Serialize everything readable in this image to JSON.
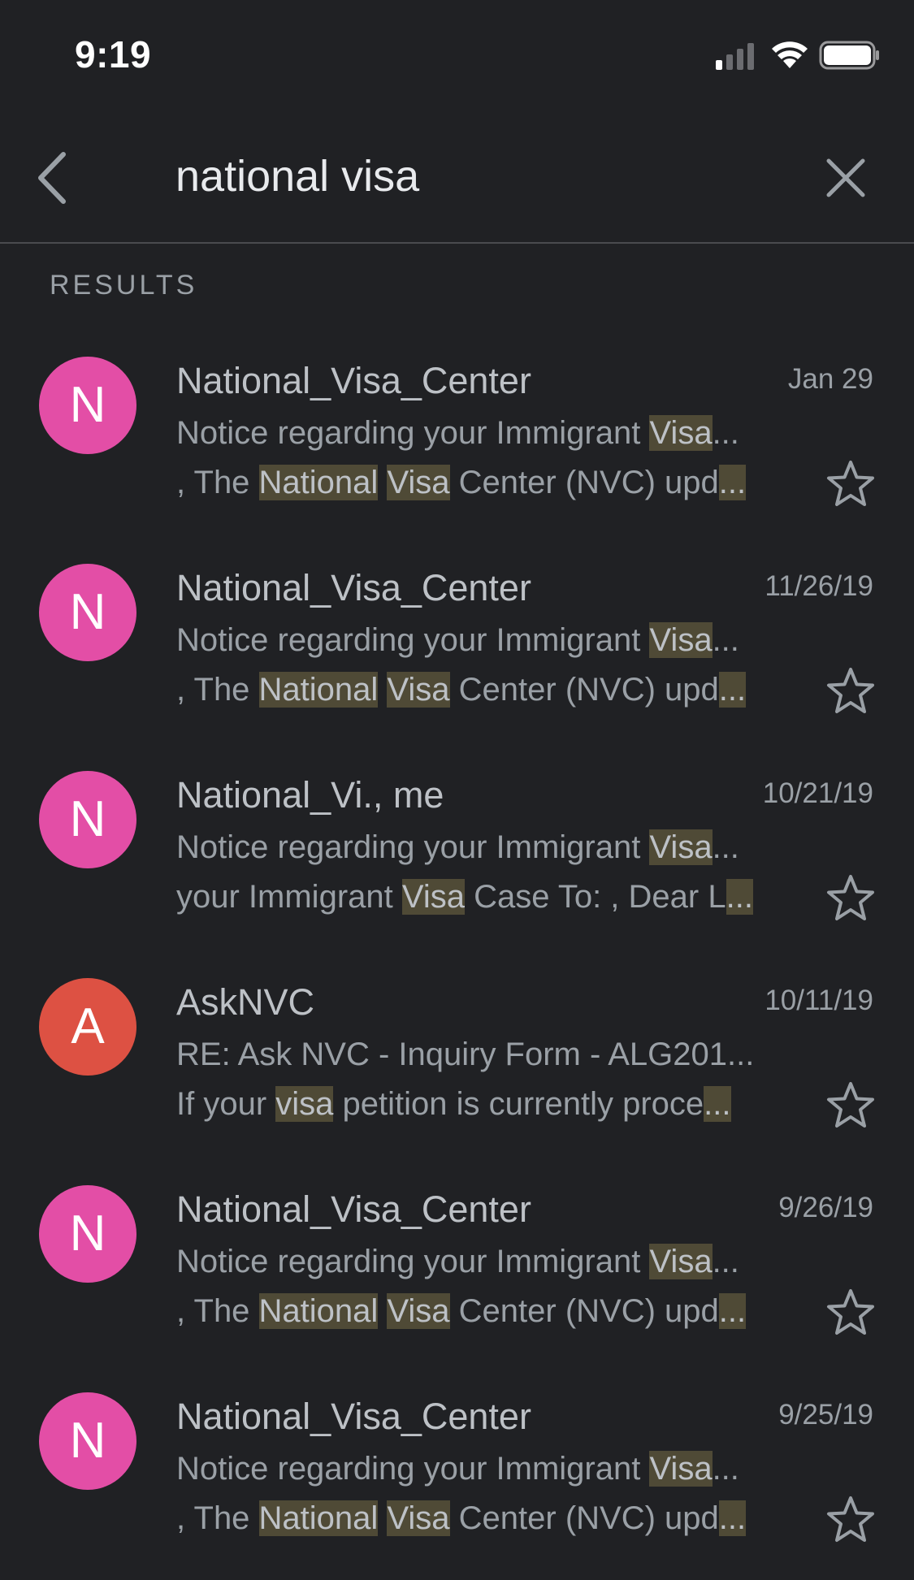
{
  "status_bar": {
    "time": "9:19"
  },
  "search": {
    "query": "national visa"
  },
  "results_label": "RESULTS",
  "colors": {
    "avatar_pink": "#e34ea6",
    "avatar_orange": "#dd5143",
    "highlight": "#4f4a36",
    "background": "#202124"
  },
  "emails": [
    {
      "avatar_letter": "N",
      "avatar_color": "#e34ea6",
      "sender": "National_Visa_Center",
      "date": "Jan 29",
      "subject": [
        {
          "t": "Notice regarding your Immigrant ",
          "h": false
        },
        {
          "t": "Visa",
          "h": true
        },
        {
          "t": "...",
          "h": false
        }
      ],
      "snippet": [
        {
          "t": ", The ",
          "h": false
        },
        {
          "t": "National",
          "h": true
        },
        {
          "t": " ",
          "h": false
        },
        {
          "t": "Visa",
          "h": true
        },
        {
          "t": " Center (NVC) upd",
          "h": false
        },
        {
          "t": "...",
          "h": true
        }
      ]
    },
    {
      "avatar_letter": "N",
      "avatar_color": "#e34ea6",
      "sender": "National_Visa_Center",
      "date": "11/26/19",
      "subject": [
        {
          "t": "Notice regarding your Immigrant ",
          "h": false
        },
        {
          "t": "Visa",
          "h": true
        },
        {
          "t": "...",
          "h": false
        }
      ],
      "snippet": [
        {
          "t": ", The ",
          "h": false
        },
        {
          "t": "National",
          "h": true
        },
        {
          "t": " ",
          "h": false
        },
        {
          "t": "Visa",
          "h": true
        },
        {
          "t": " Center (NVC) upd",
          "h": false
        },
        {
          "t": "...",
          "h": true
        }
      ]
    },
    {
      "avatar_letter": "N",
      "avatar_color": "#e34ea6",
      "sender": "National_Vi., me",
      "date": "10/21/19",
      "subject": [
        {
          "t": "Notice regarding your Immigrant ",
          "h": false
        },
        {
          "t": "Visa",
          "h": true
        },
        {
          "t": "...",
          "h": false
        }
      ],
      "snippet": [
        {
          "t": "your Immigrant ",
          "h": false
        },
        {
          "t": "Visa",
          "h": true
        },
        {
          "t": " Case To: , Dear L",
          "h": false
        },
        {
          "t": "...",
          "h": true
        }
      ]
    },
    {
      "avatar_letter": "A",
      "avatar_color": "#dd5143",
      "sender": "AskNVC",
      "date": "10/11/19",
      "subject": [
        {
          "t": "RE: Ask NVC - Inquiry Form - ALG201...",
          "h": false
        }
      ],
      "snippet": [
        {
          "t": "If your ",
          "h": false
        },
        {
          "t": "visa",
          "h": true
        },
        {
          "t": " petition is currently proce",
          "h": false
        },
        {
          "t": "...",
          "h": true
        }
      ]
    },
    {
      "avatar_letter": "N",
      "avatar_color": "#e34ea6",
      "sender": "National_Visa_Center",
      "date": "9/26/19",
      "subject": [
        {
          "t": "Notice regarding your Immigrant ",
          "h": false
        },
        {
          "t": "Visa",
          "h": true
        },
        {
          "t": "...",
          "h": false
        }
      ],
      "snippet": [
        {
          "t": ", The ",
          "h": false
        },
        {
          "t": "National",
          "h": true
        },
        {
          "t": " ",
          "h": false
        },
        {
          "t": "Visa",
          "h": true
        },
        {
          "t": " Center (NVC) upd",
          "h": false
        },
        {
          "t": "...",
          "h": true
        }
      ]
    },
    {
      "avatar_letter": "N",
      "avatar_color": "#e34ea6",
      "sender": "National_Visa_Center",
      "date": "9/25/19",
      "subject": [
        {
          "t": "Notice regarding your Immigrant ",
          "h": false
        },
        {
          "t": "Visa",
          "h": true
        },
        {
          "t": "...",
          "h": false
        }
      ],
      "snippet": [
        {
          "t": ", The ",
          "h": false
        },
        {
          "t": "National",
          "h": true
        },
        {
          "t": " ",
          "h": false
        },
        {
          "t": "Visa",
          "h": true
        },
        {
          "t": " Center (NVC) upd",
          "h": false
        },
        {
          "t": "...",
          "h": true
        }
      ]
    }
  ]
}
